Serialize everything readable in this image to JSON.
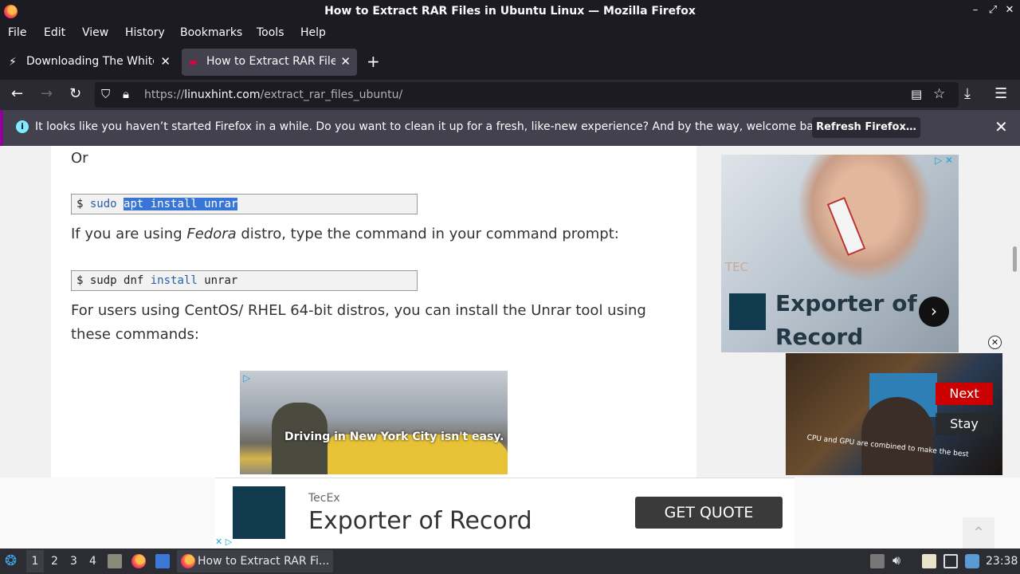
{
  "window": {
    "title": "How to Extract RAR Files in Ubuntu Linux — Mozilla Firefox",
    "controls": [
      "–",
      "⤢",
      "✕"
    ]
  },
  "menu": [
    "File",
    "Edit",
    "View",
    "History",
    "Bookmarks",
    "Tools",
    "Help"
  ],
  "tabs": [
    {
      "label": "Downloading The White",
      "active": false
    },
    {
      "label": "How to Extract RAR Files",
      "active": true
    }
  ],
  "nav": {
    "url_prefix": "https://",
    "url_domain": "linuxhint.com",
    "url_path": "/extract_rar_files_ubuntu/"
  },
  "notification": {
    "text": "It looks like you haven’t started Firefox in a while. Do you want to clean it up for a fresh, like-new experience? And by the way, welcome back!",
    "button": "Refresh Firefox…"
  },
  "article": {
    "or_text": "Or",
    "code1": {
      "prompt": "$",
      "cmd": "sudo",
      "selected": "apt install unrar"
    },
    "fedora_pre": "If you are using ",
    "fedora_em": "Fedora",
    "fedora_post": " distro, type the command in your command prompt:",
    "code2": {
      "prompt": "$",
      "cmd": "sudp dnf",
      "kw": "install",
      "arg": "unrar"
    },
    "centos_line1": "For users using CentOS/ RHEL 64-bit distros, you can install the Unrar tool using",
    "centos_line2": "these commands:",
    "inline_ad_text": "Driving in New York City isn't easy."
  },
  "side_ad": {
    "tec": "TEC",
    "headline_line1": "Exporter of",
    "headline_line2": "Record",
    "arrow": "›"
  },
  "video": {
    "caption": "CPU and GPU are combined to make the best",
    "next": "Next",
    "stay": "Stay"
  },
  "bottom_ad": {
    "brand": "TecEx",
    "headline": "Exporter of Record",
    "button": "GET QUOTE"
  },
  "taskbar": {
    "workspaces": [
      "1",
      "2",
      "3",
      "4"
    ],
    "task_label": "How to Extract RAR Fi...",
    "clock": "23:38"
  }
}
